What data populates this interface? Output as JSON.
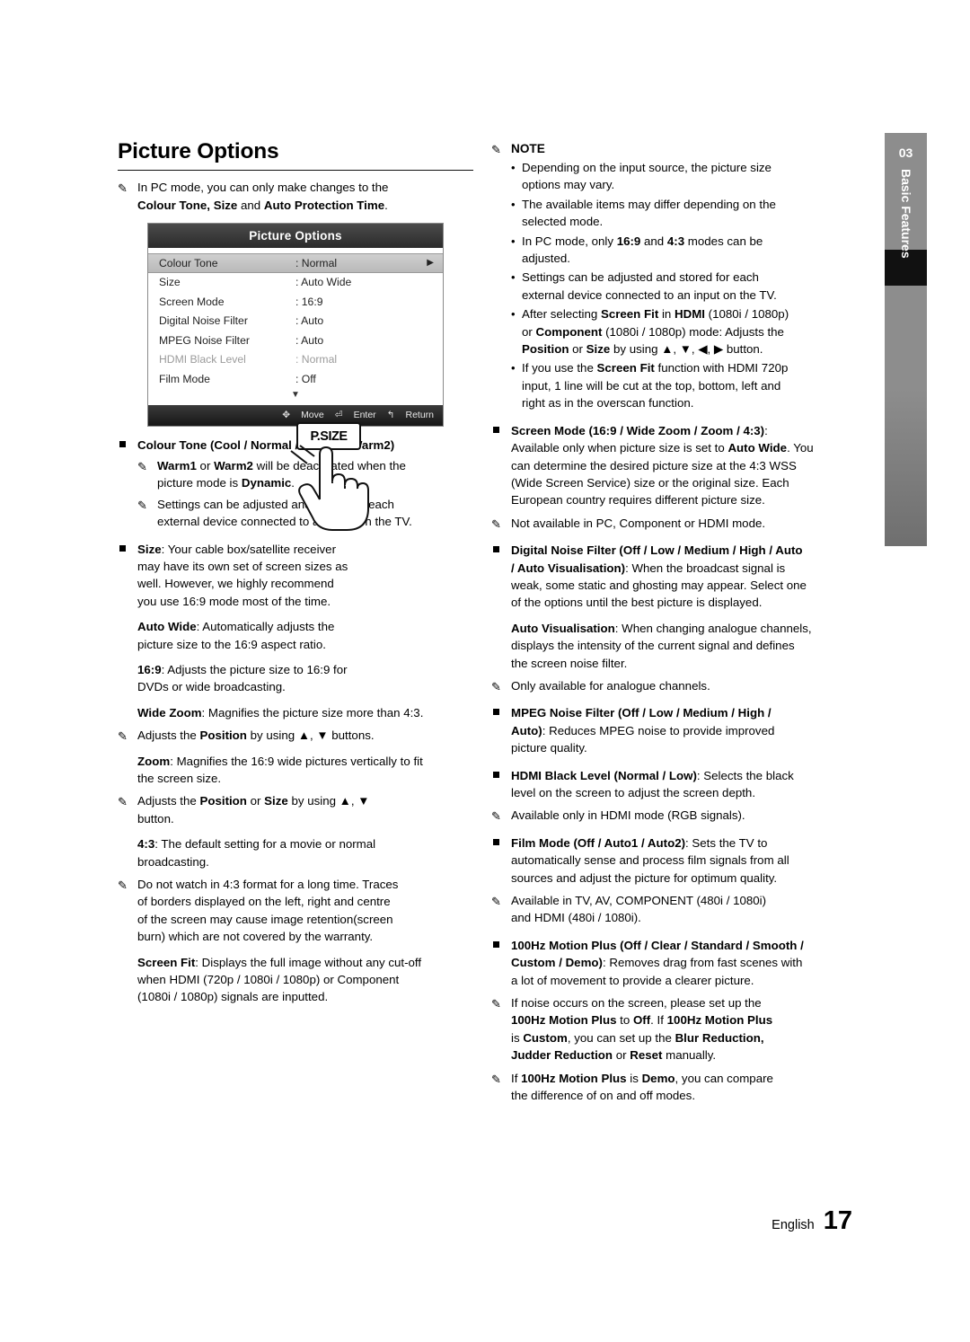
{
  "side_tab": {
    "number": "03",
    "label": "Basic Features"
  },
  "left": {
    "title": "Picture Options",
    "intro": {
      "pen": "✎",
      "line1_a": "In PC mode, you can only make changes to the",
      "line2_a": "Colour Tone, Size",
      "line2_b": " and ",
      "line2_c": "Auto Protection Time",
      "line2_d": "."
    },
    "osd": {
      "title": "Picture Options",
      "rows": [
        {
          "key": "Colour Tone",
          "value": ": Normal",
          "arrow": "▶",
          "selected": true,
          "dim": false
        },
        {
          "key": "Size",
          "value": ": Auto Wide",
          "arrow": "",
          "selected": false,
          "dim": false
        },
        {
          "key": "Screen Mode",
          "value": ": 16:9",
          "arrow": "",
          "selected": false,
          "dim": false
        },
        {
          "key": "Digital Noise Filter",
          "value": ": Auto",
          "arrow": "",
          "selected": false,
          "dim": false
        },
        {
          "key": "MPEG Noise Filter",
          "value": ": Auto",
          "arrow": "",
          "selected": false,
          "dim": false
        },
        {
          "key": "HDMI Black Level",
          "value": ": Normal",
          "arrow": "",
          "selected": false,
          "dim": true
        },
        {
          "key": "Film Mode",
          "value": ": Off",
          "arrow": "",
          "selected": false,
          "dim": false
        }
      ],
      "scroll_down": "▼",
      "footer": {
        "move_icon": "✥",
        "move": "Move",
        "enter_icon": "⏎",
        "enter": "Enter",
        "return_icon": "↰",
        "return": "Return"
      }
    },
    "colour_tone": {
      "heading": "Colour Tone (Cool / Normal / Warm1 / Warm2)",
      "note1_a": "Warm1",
      "note1_b": " or ",
      "note1_c": "Warm2",
      "note1_d": " will be deactivated when the",
      "note1_e": "picture mode is ",
      "note1_f": "Dynamic",
      "note1_g": ".",
      "note2_line1": "Settings can be adjusted and stored for each",
      "note2_line2": "external device connected to an input on the TV."
    },
    "size": {
      "heading_bold": "Size",
      "heading_rest": ": Your cable box/satellite receiver",
      "line2": "may have its own set of screen sizes as",
      "line3": "well. However, we highly recommend",
      "line4": "you use 16:9 mode most of the time.",
      "psize_button": "P.SIZE",
      "auto_wide_bold": "Auto Wide",
      "auto_wide_rest": ": Automatically adjusts the",
      "auto_wide_line2": "picture size to the 16:9 aspect ratio.",
      "r169_bold": "16:9",
      "r169_rest": ": Adjusts the picture size to 16:9 for",
      "r169_line2": "DVDs or wide broadcasting.",
      "widezoom_bold": "Wide Zoom",
      "widezoom_rest": ": Magnifies the picture size more than 4:3.",
      "widezoom_note_a": "Adjusts the ",
      "widezoom_note_b": "Position",
      "widezoom_note_c": " by using ▲, ▼ buttons.",
      "zoom_bold": "Zoom",
      "zoom_rest": ": Magnifies the 16:9 wide pictures vertically to fit",
      "zoom_line2": "the screen size.",
      "zoom_note_a": "Adjusts the ",
      "zoom_note_b": "Position",
      "zoom_note_c": " or ",
      "zoom_note_d": "Size",
      "zoom_note_e": " by using ▲, ▼",
      "zoom_note_f": "button.",
      "r43_bold": "4:3",
      "r43_rest": ": The default setting for a movie or normal",
      "r43_line2": "broadcasting.",
      "r43_note_l1": "Do not watch in 4:3 format for a long time. Traces",
      "r43_note_l2": "of borders displayed on the left, right and centre",
      "r43_note_l3": "of the screen may cause image retention(screen",
      "r43_note_l4": "burn) which are not covered by the warranty.",
      "screenfit_bold": "Screen Fit",
      "screenfit_rest": ": Displays the full image without any cut-off",
      "screenfit_l2": "when HDMI (720p / 1080i / 1080p) or Component",
      "screenfit_l3": "(1080i / 1080p) signals are inputted."
    }
  },
  "right": {
    "note_head": "NOTE",
    "note_pen": "✎",
    "notes": [
      [
        "Depending on the input source, the picture size",
        "options may vary."
      ],
      [
        "The available items may differ depending on the",
        "selected mode."
      ],
      [
        "In PC mode, only <b>16:9</b> and <b>4:3</b> modes can be",
        "adjusted."
      ],
      [
        "Settings can be adjusted and stored for each",
        "external device connected to an input on the TV."
      ],
      [
        "After selecting <b>Screen Fit</b> in <b>HDMI</b> (1080i / 1080p)",
        "or <b>Component</b> (1080i / 1080p) mode: Adjusts the",
        "<b>Position</b> or <b>Size</b> by using ▲, ▼, ◀, ▶ button."
      ],
      [
        "If you use the <b>Screen Fit</b> function with HDMI 720p",
        "input, 1 line will be cut at the top, bottom, left and",
        "right as in the overscan function."
      ]
    ],
    "screen_mode": {
      "heading_bold": "Screen Mode (16:9 / Wide Zoom / Zoom / 4:3)",
      "heading_rest": ":",
      "l1": "Available only when picture size is set to <b>Auto Wide</b>. You",
      "l2": "can determine the desired picture size at the 4:3 WSS",
      "l3": "(Wide Screen Service) size or the original size. Each",
      "l4": "European country requires different picture size.",
      "note": "Not available in PC, Component or HDMI mode."
    },
    "dnf": {
      "heading_bold": "Digital Noise Filter (Off / Low / Medium / High / Auto",
      "l2": "/ Auto Visualisation)",
      "l2_rest": ": When the broadcast signal is",
      "l3": "weak, some static and ghosting may appear. Select one",
      "l4": "of the options until the best picture is displayed.",
      "av_bold": "Auto Visualisation",
      "av_rest": ": When changing analogue channels,",
      "av_l2": "displays the intensity of the current signal and defines",
      "av_l3": "the screen noise filter.",
      "note": "Only available for analogue channels."
    },
    "mpeg": {
      "heading_bold": "MPEG Noise Filter (Off / Low / Medium / High /",
      "l2_bold": "Auto)",
      "l2_rest": ": Reduces MPEG noise to provide improved",
      "l3": "picture quality."
    },
    "hdmi_black": {
      "heading_bold": "HDMI Black Level (Normal / Low)",
      "heading_rest": ": Selects the black",
      "l2": "level on the screen to adjust the screen depth.",
      "note": "Available only in HDMI mode (RGB signals)."
    },
    "film_mode": {
      "heading_bold": "Film Mode (Off / Auto1 / Auto2)",
      "heading_rest": ": Sets the TV to",
      "l2": "automatically sense and process film signals from all",
      "l3": "sources and adjust the picture for optimum quality.",
      "note_l1": "Available in TV, AV, COMPONENT (480i / 1080i)",
      "note_l2": "and HDMI (480i / 1080i)."
    },
    "motion_plus": {
      "heading_bold": "100Hz Motion Plus (Off / Clear / Standard / Smooth /",
      "l2_bold": "Custom / Demo)",
      "l2_rest": ": Removes drag from fast scenes with",
      "l3": "a lot of movement to provide a clearer picture.",
      "note1_l1": "If noise occurs on the screen, please set up the",
      "note1_l2": "<b>100Hz Motion Plus</b> to <b>Off</b>. If <b>100Hz Motion Plus</b>",
      "note1_l3": "is <b>Custom</b>, you can set up the <b>Blur Reduction,</b>",
      "note1_l4": "<b>Judder Reduction</b> or <b>Reset</b> manually.",
      "note2_l1": "If <b>100Hz Motion Plus</b> is <b>Demo</b>, you can compare",
      "note2_l2": "the difference of on and off modes."
    }
  },
  "footer": {
    "language": "English",
    "page": "17"
  }
}
